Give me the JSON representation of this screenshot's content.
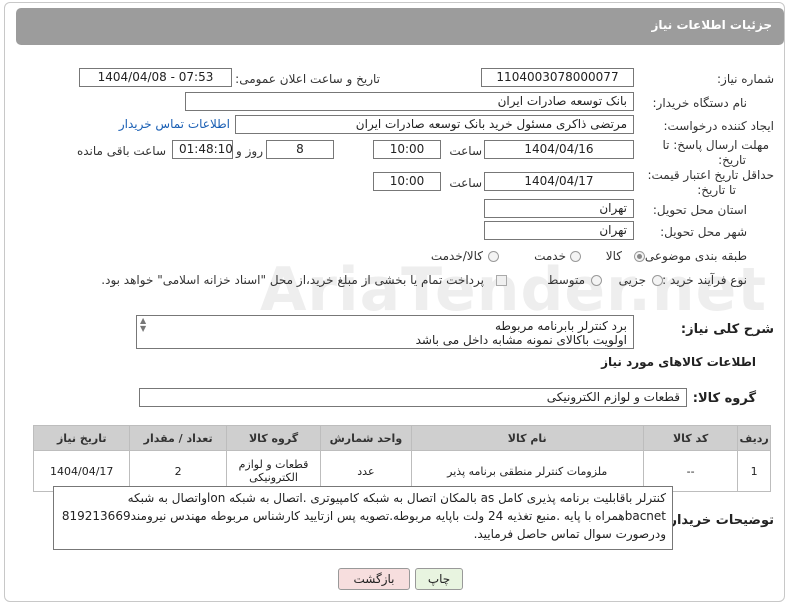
{
  "header": {
    "title": "جزئیات اطلاعات نیاز"
  },
  "labels": {
    "need_number": "شماره نیاز:",
    "announce_datetime": "تاریخ و ساعت اعلان عمومی:",
    "buyer_org": "نام دستگاه خریدار:",
    "requester": "ایجاد کننده درخواست:",
    "reply_deadline_1": "مهلت ارسال پاسخ: تا",
    "reply_deadline_2": "تاریخ:",
    "price_validity_1": "حداقل تاریخ اعتبار قیمت:",
    "price_validity_2": "تا تاریخ:",
    "hour": "ساعت",
    "day_and": "روز و",
    "hours_remaining": "ساعت باقی مانده",
    "delivery_province": "استان محل تحویل:",
    "delivery_city": "شهر محل تحویل:",
    "subject_class": "طبقه بندی موضوعی:",
    "purchase_type": "نوع فرآیند خرید :",
    "description": "شرح کلی نیاز:",
    "goods_info": "اطلاعات کالاهای مورد نیاز",
    "goods_group": "گروه کالا:",
    "buyer_notes": "توضیحات خریدار:"
  },
  "fields": {
    "need_number": "1104003078000077",
    "announce_datetime": "1404/04/08 - 07:53",
    "buyer_org": "بانک توسعه صادرات ایران",
    "requester": "مرتضی ذاکری مسئول خرید بانک توسعه صادرات ایران",
    "buyer_contact_link": "اطلاعات تماس خریدار",
    "reply_date": "1404/04/16",
    "reply_time": "10:00",
    "reply_days": "8",
    "reply_remaining": "01:48:10",
    "price_date": "1404/04/17",
    "price_time": "10:00",
    "province": "تهران",
    "city": "تهران",
    "goods_group": "قطعات و لوازم الکترونیکی"
  },
  "subject_options": [
    {
      "label": "کالا",
      "checked": true
    },
    {
      "label": "خدمت",
      "checked": false
    },
    {
      "label": "کالا/خدمت",
      "checked": false
    }
  ],
  "purchase_options": [
    {
      "label": "جزیی",
      "checked": false
    },
    {
      "label": "متوسط",
      "checked": false
    }
  ],
  "payment_note": "پرداخت تمام یا بخشی از مبلغ خرید،از محل \"اسناد خزانه اسلامی\" خواهد بود.",
  "description_lines": [
    "برد کنترلر بابرنامه مربوطه",
    "اولویت باکالای نمونه مشابه داخل می باشد"
  ],
  "table": {
    "headers": [
      "ردیف",
      "کد کالا",
      "نام کالا",
      "واحد شمارش",
      "گروه کالا",
      "تعداد / مقدار",
      "تاریخ نیاز"
    ],
    "rows": [
      [
        "1",
        "--",
        "ملزومات کنترلر منطقی برنامه پذیر",
        "عدد",
        "قطعات و لوازم الکترونیکی",
        "2",
        "1404/04/17"
      ]
    ]
  },
  "buyer_notes_text": "کنترلر باقابلیت برنامه پذیری کامل as بالمکان اتصال به شبکه کامپیوتری .اتصال به شبکه lonواتصال به شبکه bacnetهمراه با پایه .منبع تغذیه 24 ولت باپایه مربوطه.تصویه پس ازتایید کارشناس مربوطه مهندس نیرومند819213669 ودرصورت سوال تماس حاصل فرمایید.",
  "buttons": {
    "print": "چاپ",
    "back": "بازگشت"
  },
  "colors": {
    "header_bg": "#9c9c9c",
    "link": "#1a5fb4",
    "back_bg": "#f7dede",
    "print_bg": "#e8f4e0"
  },
  "watermark": "AriaTender.net"
}
